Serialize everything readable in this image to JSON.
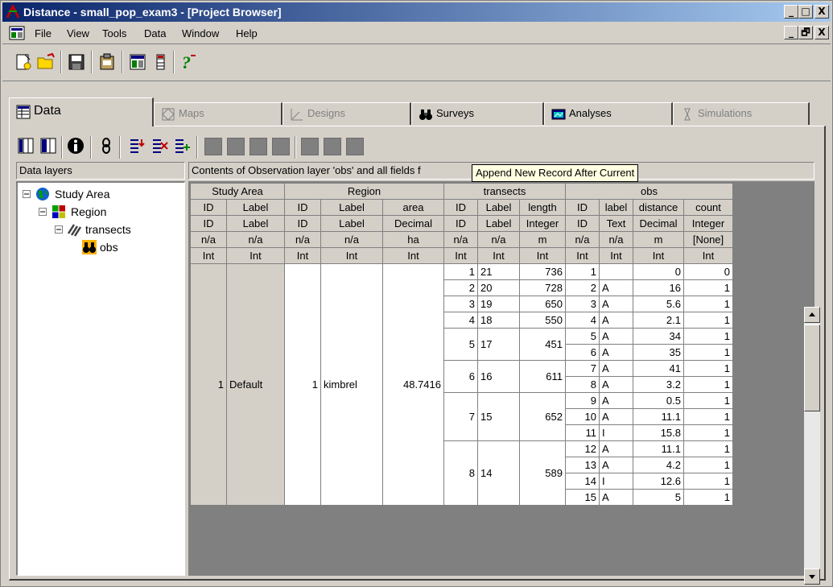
{
  "window": {
    "title": "Distance - small_pop_exam3 - [Project Browser]",
    "caption_buttons": [
      "_",
      "□",
      "X"
    ]
  },
  "menubar": {
    "items": [
      "File",
      "View",
      "Tools",
      "Data",
      "Window",
      "Help"
    ],
    "doc_buttons": [
      "_",
      "🗗",
      "X"
    ]
  },
  "tabs": [
    {
      "label": "Data",
      "icon": "data-icon",
      "state": "active"
    },
    {
      "label": "Maps",
      "icon": "maps-icon",
      "state": "disabled"
    },
    {
      "label": "Designs",
      "icon": "designs-icon",
      "state": "disabled"
    },
    {
      "label": "Surveys",
      "icon": "binoculars-icon",
      "state": "enabled"
    },
    {
      "label": "Analyses",
      "icon": "analyses-icon",
      "state": "enabled"
    },
    {
      "label": "Simulations",
      "icon": "simulations-icon",
      "state": "disabled"
    }
  ],
  "layers_header": "Data layers",
  "contents_header": "Contents of Observation layer 'obs' and all fields f",
  "tooltip": "Append New Record After Current",
  "tree": [
    {
      "label": "Study Area",
      "icon": "globe-icon"
    },
    {
      "label": "Region",
      "icon": "region-icon"
    },
    {
      "label": "transects",
      "icon": "transects-icon"
    },
    {
      "label": "obs",
      "icon": "binoculars-icon"
    }
  ],
  "grid": {
    "groups": [
      "Study Area",
      "Region",
      "transects",
      "obs"
    ],
    "field_names": [
      "ID",
      "Label",
      "ID",
      "Label",
      "area",
      "ID",
      "Label",
      "length",
      "ID",
      "label",
      "distance",
      "count"
    ],
    "field_types": [
      "ID",
      "Label",
      "ID",
      "Label",
      "Decimal",
      "ID",
      "Label",
      "Integer",
      "ID",
      "Text",
      "Decimal",
      "Integer"
    ],
    "units": [
      "n/a",
      "n/a",
      "n/a",
      "n/a",
      "ha",
      "n/a",
      "n/a",
      "m",
      "n/a",
      "n/a",
      "m",
      "[None]"
    ],
    "formats": [
      "Int",
      "Int",
      "Int",
      "Int",
      "Int",
      "Int",
      "Int",
      "Int",
      "Int",
      "Int",
      "Int",
      "Int"
    ],
    "study_area": {
      "id": "1",
      "label": "Default"
    },
    "region": {
      "id": "1",
      "label": "kimbrel",
      "area": "48.7416"
    },
    "transects": [
      {
        "id": "1",
        "label": "21",
        "length": "736",
        "obs_count": 1
      },
      {
        "id": "2",
        "label": "20",
        "length": "728",
        "obs_count": 1
      },
      {
        "id": "3",
        "label": "19",
        "length": "650",
        "obs_count": 1
      },
      {
        "id": "4",
        "label": "18",
        "length": "550",
        "obs_count": 1
      },
      {
        "id": "5",
        "label": "17",
        "length": "451",
        "obs_count": 2
      },
      {
        "id": "6",
        "label": "16",
        "length": "611",
        "obs_count": 2
      },
      {
        "id": "7",
        "label": "15",
        "length": "652",
        "obs_count": 3
      },
      {
        "id": "8",
        "label": "14",
        "length": "589",
        "obs_count": 4
      }
    ],
    "obs": [
      {
        "id": "1",
        "label": "",
        "distance": "0",
        "count": "0"
      },
      {
        "id": "2",
        "label": "A",
        "distance": "16",
        "count": "1"
      },
      {
        "id": "3",
        "label": "A",
        "distance": "5.6",
        "count": "1"
      },
      {
        "id": "4",
        "label": "A",
        "distance": "2.1",
        "count": "1"
      },
      {
        "id": "5",
        "label": "A",
        "distance": "34",
        "count": "1"
      },
      {
        "id": "6",
        "label": "A",
        "distance": "35",
        "count": "1"
      },
      {
        "id": "7",
        "label": "A",
        "distance": "41",
        "count": "1"
      },
      {
        "id": "8",
        "label": "A",
        "distance": "3.2",
        "count": "1"
      },
      {
        "id": "9",
        "label": "A",
        "distance": "0.5",
        "count": "1"
      },
      {
        "id": "10",
        "label": "A",
        "distance": "11.1",
        "count": "1"
      },
      {
        "id": "11",
        "label": "I",
        "distance": "15.8",
        "count": "1"
      },
      {
        "id": "12",
        "label": "A",
        "distance": "11.1",
        "count": "1"
      },
      {
        "id": "13",
        "label": "A",
        "distance": "4.2",
        "count": "1"
      },
      {
        "id": "14",
        "label": "I",
        "distance": "12.6",
        "count": "1"
      },
      {
        "id": "15",
        "label": "A",
        "distance": "5",
        "count": "1"
      }
    ]
  },
  "colors": {
    "title_start": "#0a246a",
    "title_end": "#a6caf0",
    "face": "#d4d0c8",
    "tooltip_bg": "#ffffe1"
  }
}
